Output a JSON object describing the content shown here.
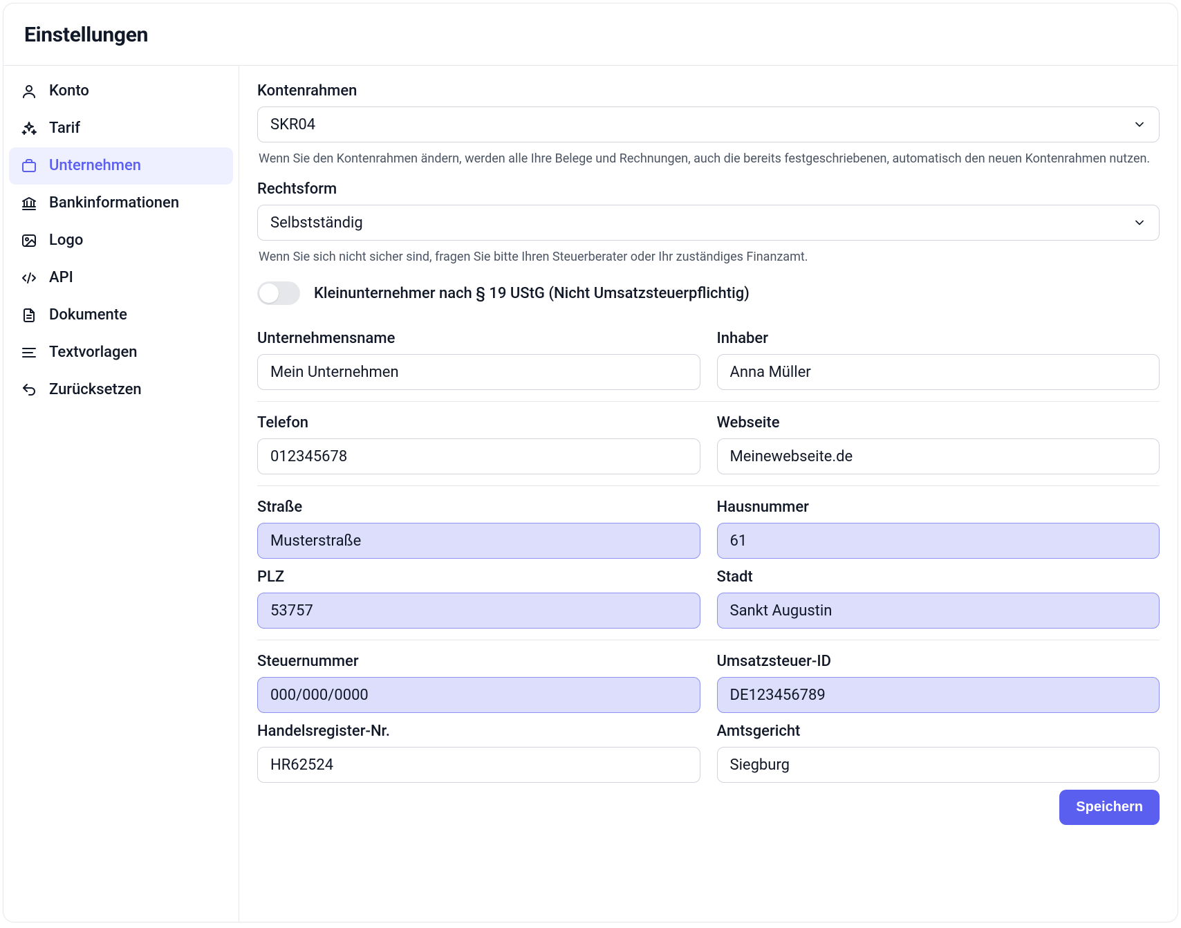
{
  "page": {
    "title": "Einstellungen",
    "save_button": "Speichern"
  },
  "sidebar": {
    "items": [
      {
        "label": "Konto"
      },
      {
        "label": "Tarif"
      },
      {
        "label": "Unternehmen"
      },
      {
        "label": "Bankinformationen"
      },
      {
        "label": "Logo"
      },
      {
        "label": "API"
      },
      {
        "label": "Dokumente"
      },
      {
        "label": "Textvorlagen"
      },
      {
        "label": "Zurücksetzen"
      }
    ]
  },
  "form": {
    "kontenrahmen": {
      "label": "Kontenrahmen",
      "value": "SKR04",
      "hint": "Wenn Sie den Kontenrahmen ändern, werden alle Ihre Belege und Rechnungen, auch die bereits festgeschriebenen, automatisch den neuen Kontenrahmen nutzen."
    },
    "rechtsform": {
      "label": "Rechtsform",
      "value": "Selbstständig",
      "hint": "Wenn Sie sich nicht sicher sind, fragen Sie bitte Ihren Steuerberater oder Ihr zuständiges Finanzamt."
    },
    "kleinunternehmer": {
      "label": "Kleinunternehmer nach § 19 UStG (Nicht Umsatzsteuerpflichtig)"
    },
    "unternehmensname": {
      "label": "Unternehmensname",
      "value": "Mein Unternehmen"
    },
    "inhaber": {
      "label": "Inhaber",
      "value": "Anna Müller"
    },
    "telefon": {
      "label": "Telefon",
      "value": "012345678"
    },
    "webseite": {
      "label": "Webseite",
      "value": "Meinewebseite.de"
    },
    "strasse": {
      "label": "Straße",
      "value": "Musterstraße"
    },
    "hausnummer": {
      "label": "Hausnummer",
      "value": "61"
    },
    "plz": {
      "label": "PLZ",
      "value": "53757"
    },
    "stadt": {
      "label": "Stadt",
      "value": "Sankt Augustin"
    },
    "steuernummer": {
      "label": "Steuernummer",
      "value": "000/000/0000"
    },
    "ustid": {
      "label": "Umsatzsteuer-ID",
      "value": "DE123456789"
    },
    "handelsregister": {
      "label": "Handelsregister-Nr.",
      "value": "HR62524"
    },
    "amtsgericht": {
      "label": "Amtsgericht",
      "value": "Siegburg"
    }
  }
}
